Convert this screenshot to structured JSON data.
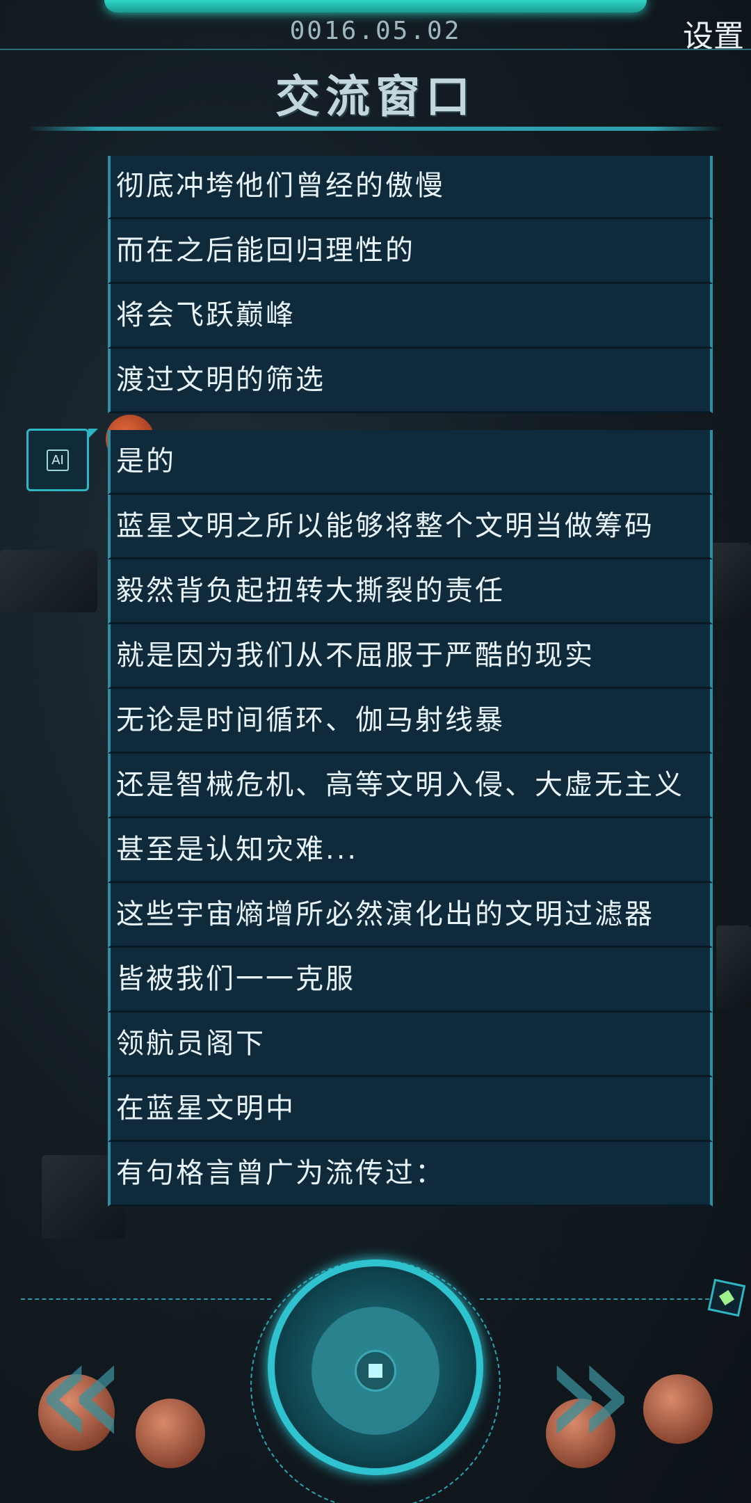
{
  "header": {
    "date": "0016.05.02",
    "settings_label": "设置",
    "title": "交流窗口"
  },
  "messages_top": [
    "彻底冲垮他们曾经的傲慢",
    "而在之后能回归理性的",
    "将会飞跃巅峰",
    "渡过文明的筛选"
  ],
  "ai_speaker": {
    "avatar_label": "AI",
    "messages": [
      "是的",
      "蓝星文明之所以能够将整个文明当做筹码",
      "毅然背负起扭转大撕裂的责任",
      "就是因为我们从不屈服于严酷的现实",
      "无论是时间循环、伽马射线暴",
      "还是智械危机、高等文明入侵、大虚无主义",
      "甚至是认知灾难...",
      "这些宇宙熵增所必然演化出的文明过滤器",
      "皆被我们一一克服",
      "领航员阁下",
      "在蓝星文明中",
      "有句格言曾广为流传过："
    ]
  },
  "controls": {
    "prev_icon": "double-chevron-left-icon",
    "next_icon": "double-chevron-right-icon",
    "center_icon": "stop-square-icon",
    "indicator_icon": "diamond-indicator-icon"
  },
  "colors": {
    "accent": "#2fc3cf",
    "bubble_bg": "#0f2a3a",
    "bubble_border": "#2b8fa3"
  }
}
